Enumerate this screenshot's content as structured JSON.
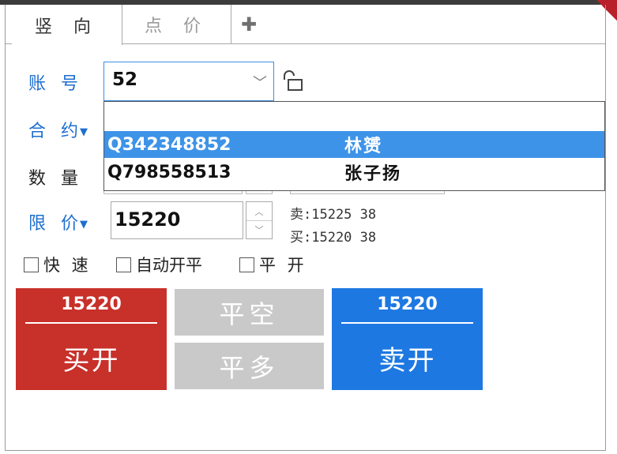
{
  "tabs": [
    {
      "label": "竖 向",
      "active": true
    },
    {
      "label": "点 价",
      "active": false
    }
  ],
  "add_tab_icon": "plus-icon",
  "form": {
    "account_label": "账 号",
    "account_value": "52",
    "contract_label": "合 约",
    "quantity_label": "数 量",
    "price_label": "限 价",
    "price_value": "15220"
  },
  "dropdown": [
    {
      "code": "Q342348852",
      "name": "林赟",
      "selected": true
    },
    {
      "code": "Q798558513",
      "name": "张子扬",
      "selected": false
    }
  ],
  "quotes": {
    "sell": "卖:15225   38",
    "buy": "买:15220   38"
  },
  "options": {
    "fast": "快 速",
    "auto": "自动开平",
    "flat_open": "平 开"
  },
  "buttons": {
    "buy_price": "15220",
    "buy_label": "买开",
    "close_short": "平空",
    "close_long": "平多",
    "sell_price": "15220",
    "sell_label": "卖开"
  },
  "colors": {
    "buy": "#c8302a",
    "sell": "#1d78e2",
    "disabled": "#c9c9c9",
    "selection": "#3d93e8",
    "accent_label": "#1e6ecf"
  }
}
